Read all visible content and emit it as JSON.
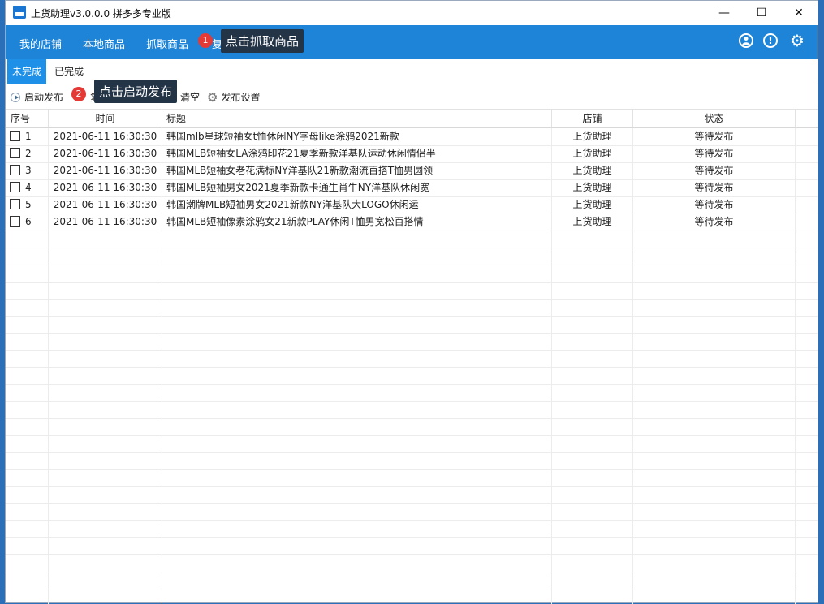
{
  "window": {
    "title": "上货助理v3.0.0.0 拼多多专业版",
    "minimize": "—",
    "maximize": "☐",
    "close": "✕"
  },
  "menu": {
    "items": [
      "我的店铺",
      "本地商品",
      "抓取商品"
    ],
    "hidden_item_char": "复",
    "tooltip1": "点击抓取商品",
    "badge1": "1"
  },
  "header_icons": {
    "user": "👤",
    "info": "!",
    "settings": "⚙"
  },
  "tabs": [
    "未完成",
    "已完成"
  ],
  "toolbar": {
    "start_publish": "启动发布",
    "badge2": "2",
    "tooltip2": "点击启动发布",
    "partial_char": "复",
    "clear": "清空",
    "publish_settings": "发布设置"
  },
  "table": {
    "columns": [
      "序号",
      "时间",
      "标题",
      "店铺",
      "状态"
    ],
    "rows": [
      {
        "no": "1",
        "time": "2021-06-11 16:30:30",
        "title": "韩国mlb星球短袖女t恤休闲NY字母like涂鸦2021新款",
        "shop": "上货助理",
        "status": "等待发布"
      },
      {
        "no": "2",
        "time": "2021-06-11 16:30:30",
        "title": "韩国MLB短袖女LA涂鸦印花21夏季新款洋基队运动休闲情侣半",
        "shop": "上货助理",
        "status": "等待发布"
      },
      {
        "no": "3",
        "time": "2021-06-11 16:30:30",
        "title": "韩国MLB短袖女老花满标NY洋基队21新款潮流百搭T恤男圆领",
        "shop": "上货助理",
        "status": "等待发布"
      },
      {
        "no": "4",
        "time": "2021-06-11 16:30:30",
        "title": "韩国MLB短袖男女2021夏季新款卡通生肖牛NY洋基队休闲宽",
        "shop": "上货助理",
        "status": "等待发布"
      },
      {
        "no": "5",
        "time": "2021-06-11 16:30:30",
        "title": "韩国潮牌MLB短袖男女2021新款NY洋基队大LOGO休闲运",
        "shop": "上货助理",
        "status": "等待发布"
      },
      {
        "no": "6",
        "time": "2021-06-11 16:30:30",
        "title": "韩国MLB短袖像素涂鸦女21新款PLAY休闲T恤男宽松百搭情",
        "shop": "上货助理",
        "status": "等待发布"
      }
    ]
  }
}
